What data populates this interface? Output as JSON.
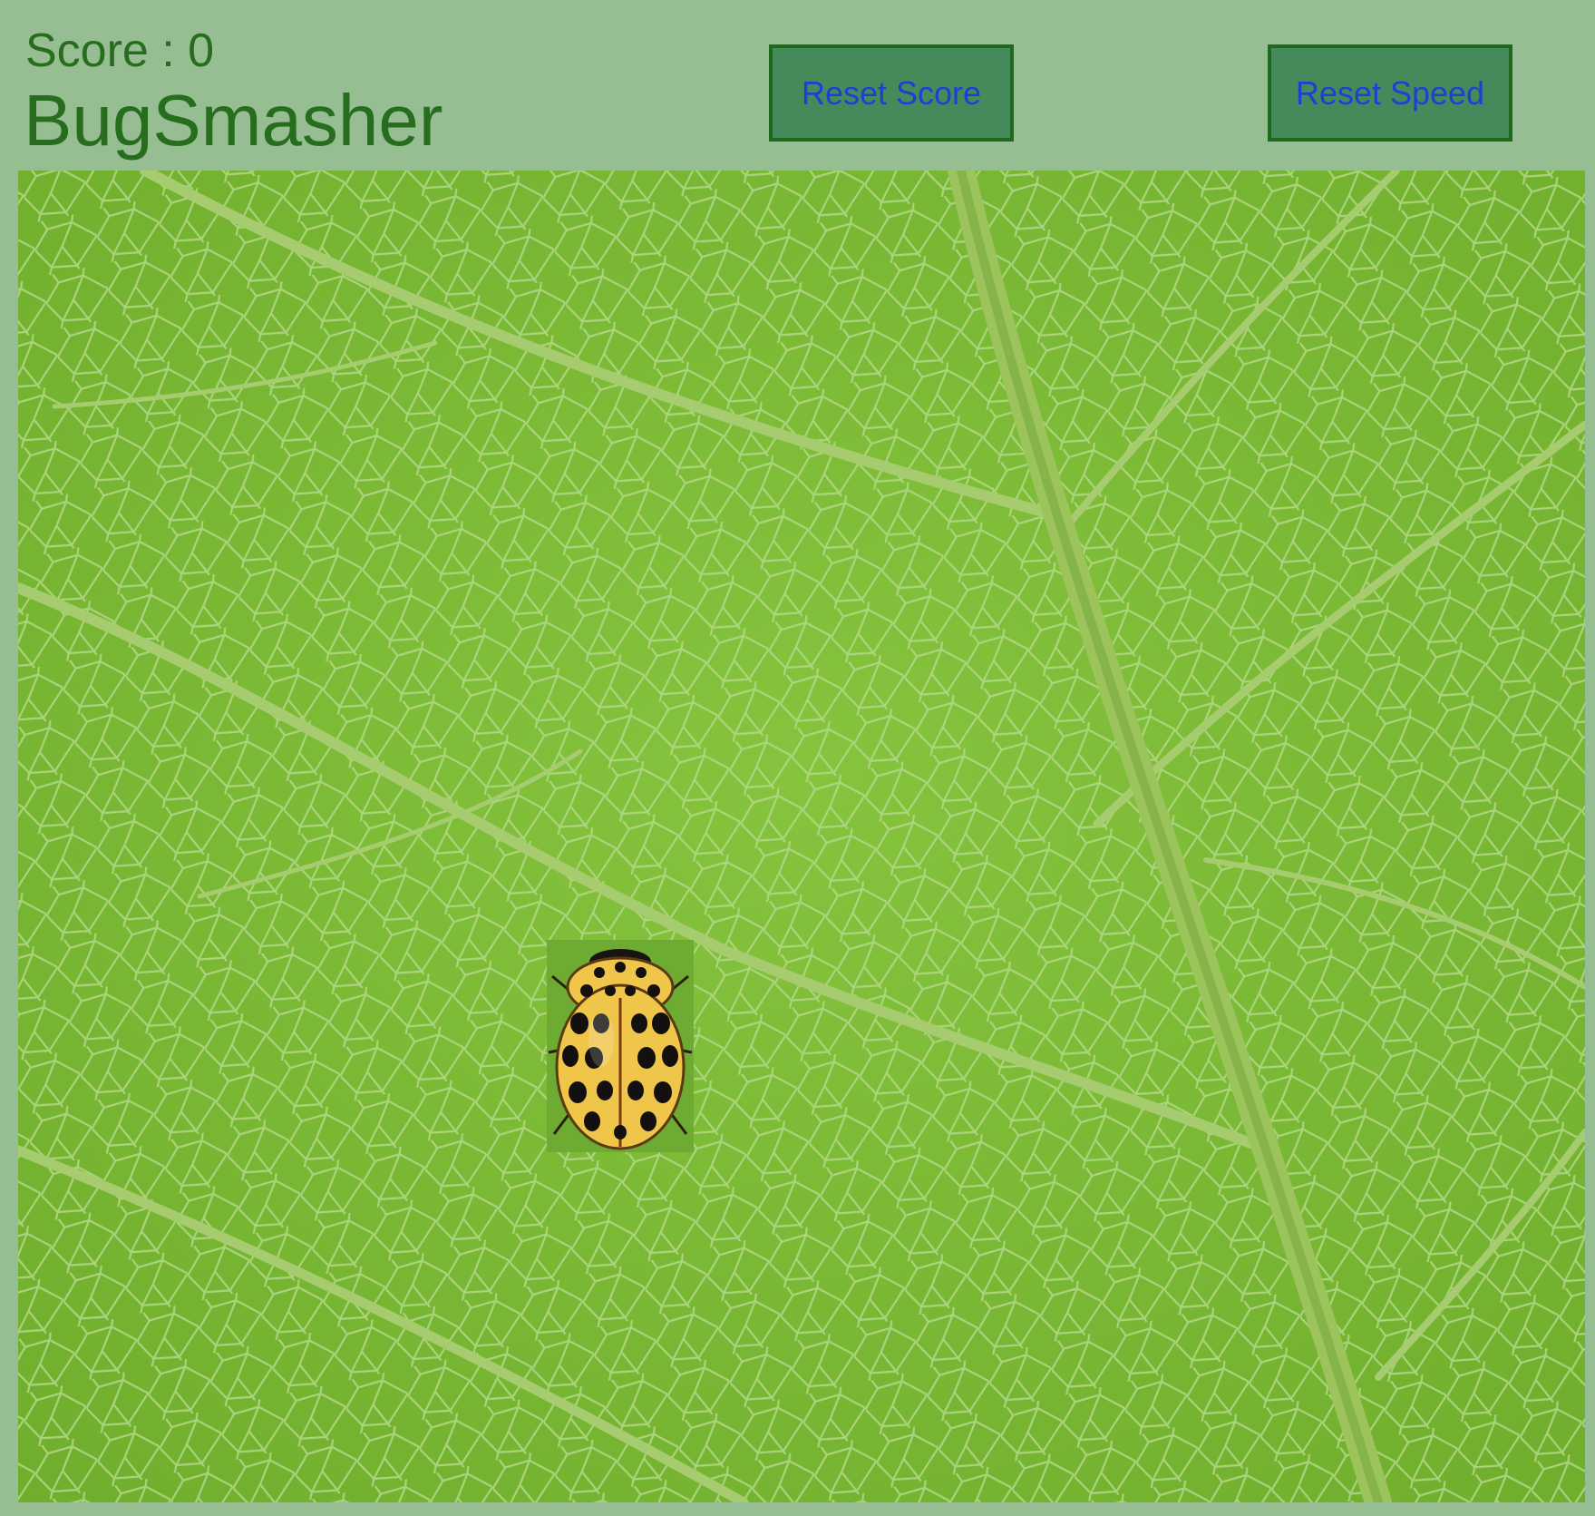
{
  "header": {
    "score_label": "Score : 0",
    "title": "BugSmasher"
  },
  "buttons": {
    "reset_score": "Reset Score",
    "reset_speed": "Reset Speed"
  },
  "game": {
    "score": 0,
    "sprite": "ladybug-icon",
    "background": "leaf-texture"
  },
  "colors": {
    "page_bg": "#97bd92",
    "text": "#266d1d",
    "button_bg": "#468a5c",
    "button_border": "#1e6a1c",
    "button_text": "#1f3fd4",
    "leaf": "#79b934",
    "vein": "#b6d98a",
    "bug_body": "#efc54a"
  }
}
